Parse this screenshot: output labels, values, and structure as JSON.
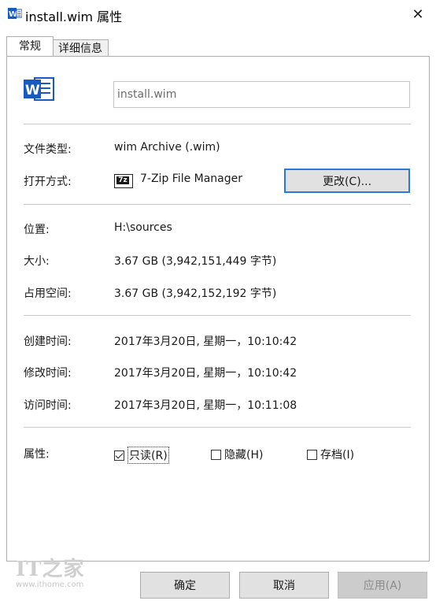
{
  "window": {
    "title": "install.wim 属性",
    "title_icon": "word-w-icon",
    "close_glyph": "✕"
  },
  "tabs": [
    {
      "label": "常规",
      "active": true
    },
    {
      "label": "详细信息",
      "active": false
    }
  ],
  "general": {
    "file_icon": "word-document-icon",
    "file_name": "install.wim",
    "file_type_label": "文件类型:",
    "file_type_value": "wim Archive (.wim)",
    "opens_with_label": "打开方式:",
    "opens_with_app_icon_text": "7z",
    "opens_with_app": "7-Zip File Manager",
    "change_button": "更改(C)...",
    "location_label": "位置:",
    "location_value": "H:\\sources",
    "size_label": "大小:",
    "size_value": "3.67 GB (3,942,151,449 字节)",
    "size_on_disk_label": "占用空间:",
    "size_on_disk_value": "3.67 GB (3,942,152,192 字节)",
    "created_label": "创建时间:",
    "created_value": "2017年3月20日, 星期一，10:10:42",
    "modified_label": "修改时间:",
    "modified_value": "2017年3月20日, 星期一，10:10:42",
    "accessed_label": "访问时间:",
    "accessed_value": "2017年3月20日, 星期一，10:11:08",
    "attributes_label": "属性:",
    "attributes": {
      "readonly": {
        "label": "只读(R)",
        "checked": true
      },
      "hidden": {
        "label": "隐藏(H)",
        "checked": false
      },
      "archive": {
        "label": "存档(I)",
        "checked": false
      }
    }
  },
  "footer": {
    "ok": "确定",
    "cancel": "取消",
    "apply": "应用(A)"
  },
  "watermark": {
    "logo": "IT之家",
    "url": "www.ithome.com"
  },
  "colors": {
    "accent": "#2b79d6",
    "word_blue": "#185abd",
    "button_face": "#e1e1e1"
  }
}
